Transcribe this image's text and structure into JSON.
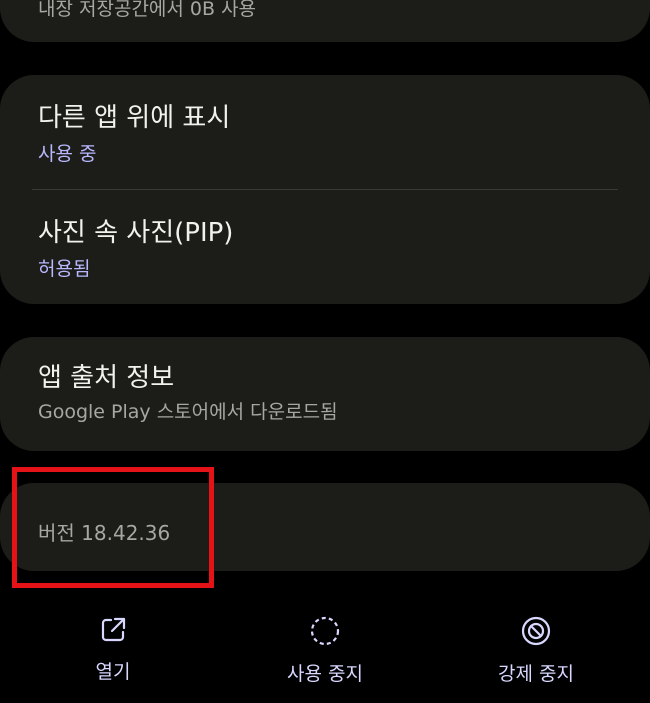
{
  "storage": {
    "subtitle": "내장 저장공간에서 0B 사용"
  },
  "permissions": {
    "overlay": {
      "title": "다른 앱 위에 표시",
      "status": "사용 중"
    },
    "pip": {
      "title": "사진 속 사진(PIP)",
      "status": "허용됨"
    }
  },
  "source": {
    "title": "앱 출처 정보",
    "subtitle": "Google Play 스토어에서 다운로드됨"
  },
  "version": {
    "text": "버전 18.42.36"
  },
  "actions": {
    "open": {
      "label": "열기",
      "icon": "open-external-icon"
    },
    "disable": {
      "label": "사용 중지",
      "icon": "dashed-circle-icon"
    },
    "force_stop": {
      "label": "강제 중지",
      "icon": "stop-circle-icon"
    }
  },
  "colors": {
    "background": "#000000",
    "card": "#1c1c18",
    "accent": "#b8b8ff",
    "highlight": "#e51317"
  }
}
